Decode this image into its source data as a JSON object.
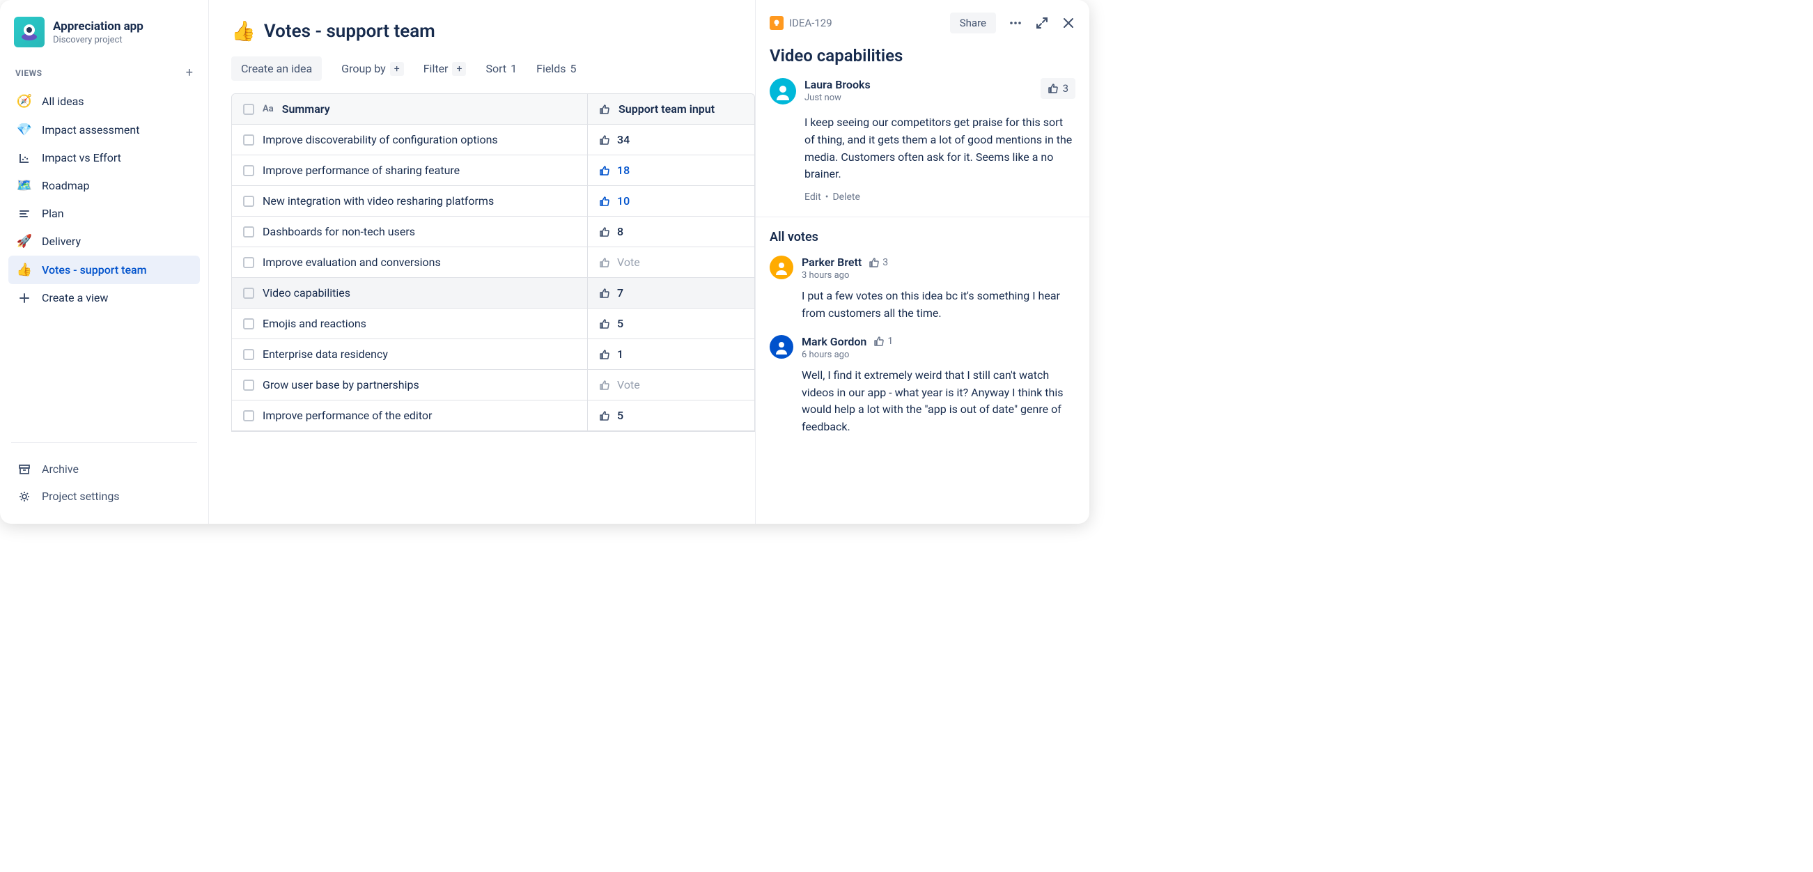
{
  "project": {
    "title": "Appreciation app",
    "subtitle": "Discovery project"
  },
  "sidebar": {
    "viewsLabel": "VIEWS",
    "items": [
      {
        "icon": "🧭",
        "label": "All ideas"
      },
      {
        "icon": "💎",
        "label": "Impact assessment"
      },
      {
        "icon": "chart",
        "label": "Impact vs Effort"
      },
      {
        "icon": "🗺️",
        "label": "Roadmap"
      },
      {
        "icon": "plan",
        "label": "Plan"
      },
      {
        "icon": "🚀",
        "label": "Delivery"
      },
      {
        "icon": "👍",
        "label": "Votes - support team"
      },
      {
        "icon": "plus",
        "label": "Create a view"
      }
    ],
    "bottom": [
      {
        "icon": "archive",
        "label": "Archive"
      },
      {
        "icon": "gear",
        "label": "Project settings"
      }
    ]
  },
  "view": {
    "emoji": "👍",
    "title": "Votes - support team",
    "toolbar": {
      "create": "Create an idea",
      "groupBy": "Group by",
      "filter": "Filter",
      "sort": "Sort",
      "sortCount": "1",
      "fields": "Fields",
      "fieldsCount": "5"
    },
    "columns": {
      "summary": "Summary",
      "support": "Support team input"
    },
    "rows": [
      {
        "summary": "Improve discoverability of configuration options",
        "votes": "34",
        "style": "normal"
      },
      {
        "summary": "Improve performance of sharing feature",
        "votes": "18",
        "style": "blue"
      },
      {
        "summary": "New integration with video resharing platforms",
        "votes": "10",
        "style": "blue"
      },
      {
        "summary": "Dashboards for non-tech users",
        "votes": "8",
        "style": "normal"
      },
      {
        "summary": "Improve evaluation and conversions",
        "votes": "Vote",
        "style": "muted"
      },
      {
        "summary": "Video capabilities",
        "votes": "7",
        "style": "normal",
        "selected": true
      },
      {
        "summary": "Emojis and reactions",
        "votes": "5",
        "style": "normal"
      },
      {
        "summary": "Enterprise data residency",
        "votes": "1",
        "style": "normal"
      },
      {
        "summary": "Grow user base by partnerships",
        "votes": "Vote",
        "style": "muted"
      },
      {
        "summary": "Improve performance of the editor",
        "votes": "5",
        "style": "normal"
      }
    ]
  },
  "detail": {
    "ideaKey": "IDEA-129",
    "share": "Share",
    "title": "Video capabilities",
    "primary": {
      "author": "Laura Brooks",
      "time": "Just now",
      "voteCount": "3",
      "body": "I keep seeing our competitors get praise for this sort of thing, and it gets them a lot of good mentions in the media. Customers often ask for it. Seems like a no brainer.",
      "edit": "Edit",
      "delete": "Delete"
    },
    "allVotesLabel": "All votes",
    "votes": [
      {
        "author": "Parker Brett",
        "voteCount": "3",
        "time": "3 hours ago",
        "body": "I put a few votes on this idea bc it's something I hear from customers all the time."
      },
      {
        "author": "Mark Gordon",
        "voteCount": "1",
        "time": "6 hours ago",
        "body": "Well, I find it extremely weird that I still can't watch videos in our app - what year is it? Anyway I think this would help a lot with the \"app is out of date\" genre of feedback."
      }
    ]
  }
}
